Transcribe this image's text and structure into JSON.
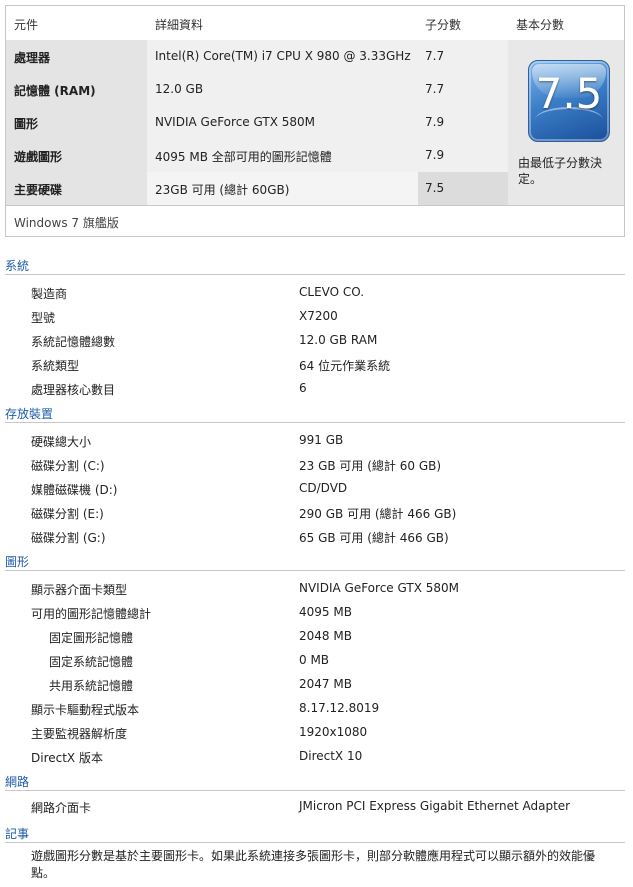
{
  "score_table": {
    "headers": {
      "component": "元件",
      "details": "詳細資料",
      "subscore": "子分數",
      "base": "基本分數"
    },
    "rows": [
      {
        "name": "處理器",
        "detail": "Intel(R) Core(TM) i7 CPU X 980 @ 3.33GHz",
        "score": "7.7"
      },
      {
        "name": "記憶體 (RAM)",
        "detail": "12.0 GB",
        "score": "7.7"
      },
      {
        "name": "圖形",
        "detail": "NVIDIA GeForce GTX 580M",
        "score": "7.9"
      },
      {
        "name": "遊戲圖形",
        "detail": "4095 MB 全部可用的圖形記憶體",
        "score": "7.9"
      },
      {
        "name": "主要硬碟",
        "detail": "23GB 可用 (總計 60GB)",
        "score": "7.5"
      }
    ],
    "base_score": "7.5",
    "base_caption": "由最低子分數決定。",
    "edition": "Windows 7 旗艦版"
  },
  "sections": {
    "system": {
      "title": "系統",
      "items": [
        {
          "key": "製造商",
          "value": "CLEVO CO."
        },
        {
          "key": "型號",
          "value": "X7200"
        },
        {
          "key": "系統記憶體總數",
          "value": "12.0 GB RAM"
        },
        {
          "key": "系統類型",
          "value": "64 位元作業系統"
        },
        {
          "key": "處理器核心數目",
          "value": "6"
        }
      ]
    },
    "storage": {
      "title": "存放裝置",
      "items": [
        {
          "key": "硬碟總大小",
          "value": "991 GB"
        },
        {
          "key": "磁碟分割 (C:)",
          "value": "23 GB 可用 (總計 60 GB)"
        },
        {
          "key": "媒體磁碟機 (D:)",
          "value": "CD/DVD"
        },
        {
          "key": "磁碟分割 (E:)",
          "value": "290 GB 可用 (總計 466 GB)"
        },
        {
          "key": "磁碟分割 (G:)",
          "value": "65 GB 可用 (總計 466 GB)"
        }
      ]
    },
    "graphics": {
      "title": "圖形",
      "items": [
        {
          "key": "顯示器介面卡類型",
          "value": "NVIDIA GeForce GTX 580M"
        },
        {
          "key": "可用的圖形記憶體總計",
          "value": "4095 MB"
        },
        {
          "key": "固定圖形記憶體",
          "value": "2048 MB"
        },
        {
          "key": "固定系統記憶體",
          "value": "0 MB"
        },
        {
          "key": "共用系統記憶體",
          "value": "2047 MB"
        },
        {
          "key": "顯示卡驅動程式版本",
          "value": "8.17.12.8019"
        },
        {
          "key": "主要監視器解析度",
          "value": "1920x1080"
        },
        {
          "key": "DirectX 版本",
          "value": "DirectX 10"
        }
      ]
    },
    "network": {
      "title": "網路",
      "items": [
        {
          "key": "網路介面卡",
          "value": "JMicron PCI Express Gigabit Ethernet Adapter"
        }
      ]
    },
    "notes": {
      "title": "記事",
      "text": "遊戲圖形分數是基於主要圖形卡。如果此系統連接多張圖形卡，則部分軟體應用程式可以顯示額外的效能優點。"
    }
  }
}
